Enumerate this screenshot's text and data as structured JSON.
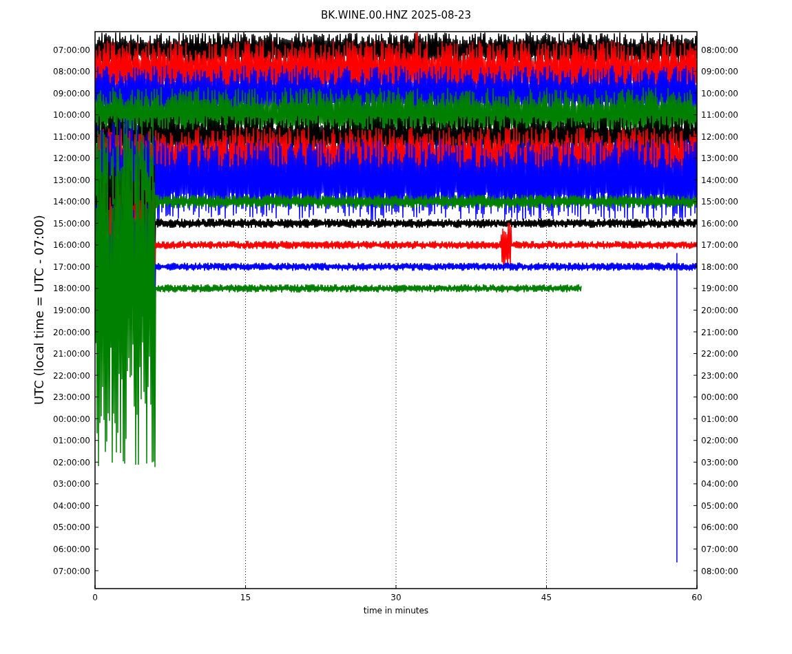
{
  "chart": {
    "title": "BK.WINE.00.HNZ 2025-08-23",
    "ylabel": "UTC (local time = UTC - 07:00)",
    "xlabel": "time in minutes",
    "xticks": [
      "0",
      "15",
      "30",
      "45",
      "60"
    ],
    "rows": [
      {
        "left": "07:00:00",
        "right": "08:00:00",
        "color": "#000000"
      },
      {
        "left": "08:00:00",
        "right": "09:00:00",
        "color": "#ff0000"
      },
      {
        "left": "09:00:00",
        "right": "10:00:00",
        "color": "#0000ff"
      },
      {
        "left": "10:00:00",
        "right": "11:00:00",
        "color": "#008000"
      },
      {
        "left": "11:00:00",
        "right": "12:00:00",
        "color": "#000000"
      },
      {
        "left": "12:00:00",
        "right": "13:00:00",
        "color": "#ff0000"
      },
      {
        "left": "13:00:00",
        "right": "14:00:00",
        "color": "#0000ff"
      },
      {
        "left": "14:00:00",
        "right": "15:00:00",
        "color": "#008000"
      },
      {
        "left": "15:00:00",
        "right": "16:00:00",
        "color": "#000000"
      },
      {
        "left": "16:00:00",
        "right": "17:00:00",
        "color": "#ff0000"
      },
      {
        "left": "17:00:00",
        "right": "18:00:00",
        "color": "#0000ff"
      },
      {
        "left": "18:00:00",
        "right": "19:00:00",
        "color": "#008000"
      },
      {
        "left": "19:00:00",
        "right": "20:00:00"
      },
      {
        "left": "20:00:00",
        "right": "21:00:00"
      },
      {
        "left": "21:00:00",
        "right": "22:00:00"
      },
      {
        "left": "22:00:00",
        "right": "23:00:00"
      },
      {
        "left": "23:00:00",
        "right": "00:00:00"
      },
      {
        "left": "00:00:00",
        "right": "01:00:00"
      },
      {
        "left": "01:00:00",
        "right": "02:00:00"
      },
      {
        "left": "02:00:00",
        "right": "03:00:00"
      },
      {
        "left": "03:00:00",
        "right": "04:00:00"
      },
      {
        "left": "04:00:00",
        "right": "05:00:00"
      },
      {
        "left": "05:00:00",
        "right": "06:00:00"
      },
      {
        "left": "06:00:00",
        "right": "07:00:00"
      },
      {
        "left": "07:00:00",
        "right": "08:00:00"
      }
    ]
  }
}
